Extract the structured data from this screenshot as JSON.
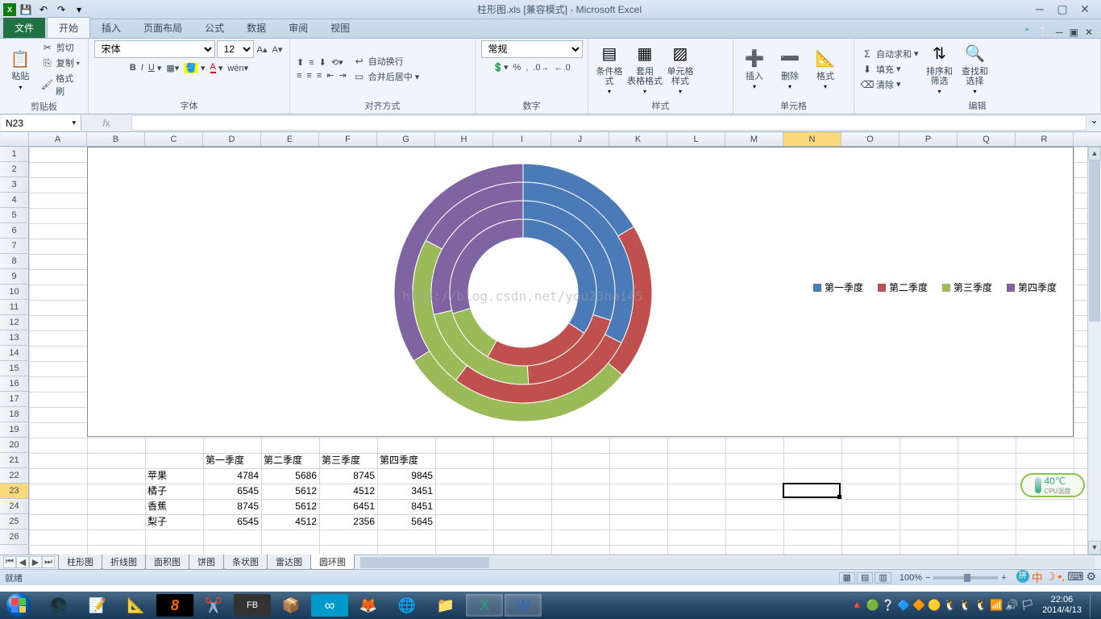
{
  "titlebar": {
    "title": "柱形图.xls [兼容模式] - Microsoft Excel"
  },
  "tabs": {
    "file": "文件",
    "home": "开始",
    "insert": "插入",
    "layout": "页面布局",
    "formulas": "公式",
    "data": "数据",
    "review": "审阅",
    "view": "视图"
  },
  "ribbon": {
    "clipboard": {
      "label": "剪贴板",
      "paste": "粘贴",
      "cut": "剪切",
      "copy": "复制",
      "format_painter": "格式刷"
    },
    "font": {
      "label": "字体",
      "name": "宋体",
      "size": "12"
    },
    "align": {
      "label": "对齐方式",
      "wrap": "自动换行",
      "merge": "合并后居中"
    },
    "number": {
      "label": "数字",
      "format": "常规"
    },
    "styles": {
      "label": "样式",
      "cond": "条件格式",
      "table": "套用\n表格格式",
      "cell": "单元格样式"
    },
    "cells": {
      "label": "单元格",
      "insert": "插入",
      "delete": "删除",
      "format": "格式"
    },
    "editing": {
      "label": "编辑",
      "sum": "自动求和",
      "fill": "填充",
      "clear": "清除",
      "sort": "排序和筛选",
      "find": "查找和选择"
    }
  },
  "namebox": "N23",
  "columns": [
    "A",
    "B",
    "C",
    "D",
    "E",
    "F",
    "G",
    "H",
    "I",
    "J",
    "K",
    "L",
    "M",
    "N",
    "O",
    "P",
    "Q",
    "R"
  ],
  "rows_visible": 26,
  "active_row": 23,
  "active_col": "N",
  "table": {
    "headers": [
      "第一季度",
      "第二季度",
      "第三季度",
      "第四季度"
    ],
    "rows": [
      {
        "label": "苹果",
        "values": [
          4784,
          5686,
          8745,
          9845
        ]
      },
      {
        "label": "橘子",
        "values": [
          6545,
          5612,
          4512,
          3451
        ]
      },
      {
        "label": "香蕉",
        "values": [
          8745,
          5612,
          6451,
          8451
        ]
      },
      {
        "label": "梨子",
        "values": [
          6545,
          4512,
          2356,
          5645
        ]
      }
    ]
  },
  "chart_data": {
    "type": "doughnut",
    "title": "",
    "categories": [
      "苹果",
      "橘子",
      "香蕉",
      "梨子"
    ],
    "series": [
      {
        "name": "第一季度",
        "values": [
          4784,
          6545,
          8745,
          6545
        ],
        "color": "#4a7ab8"
      },
      {
        "name": "第二季度",
        "values": [
          5686,
          5612,
          5612,
          4512
        ],
        "color": "#c0504d"
      },
      {
        "name": "第三季度",
        "values": [
          8745,
          4512,
          6451,
          2356
        ],
        "color": "#9bbb59"
      },
      {
        "name": "第四季度",
        "values": [
          9845,
          3451,
          8451,
          5645
        ],
        "color": "#8064a2"
      }
    ],
    "legend_position": "right"
  },
  "watermark": "http://blog.csdn.net/you23hai45",
  "cpu": {
    "temp": "40℃",
    "label": "CPU温度"
  },
  "sheet_tabs": [
    "柱形图",
    "折线图",
    "面积图",
    "饼图",
    "条状图",
    "雷达图",
    "圆环图"
  ],
  "sheet_active": "圆环图",
  "status": {
    "ready": "就绪",
    "zoom": "100%"
  },
  "clock": {
    "time": "22:06",
    "date": "2014/4/13"
  }
}
